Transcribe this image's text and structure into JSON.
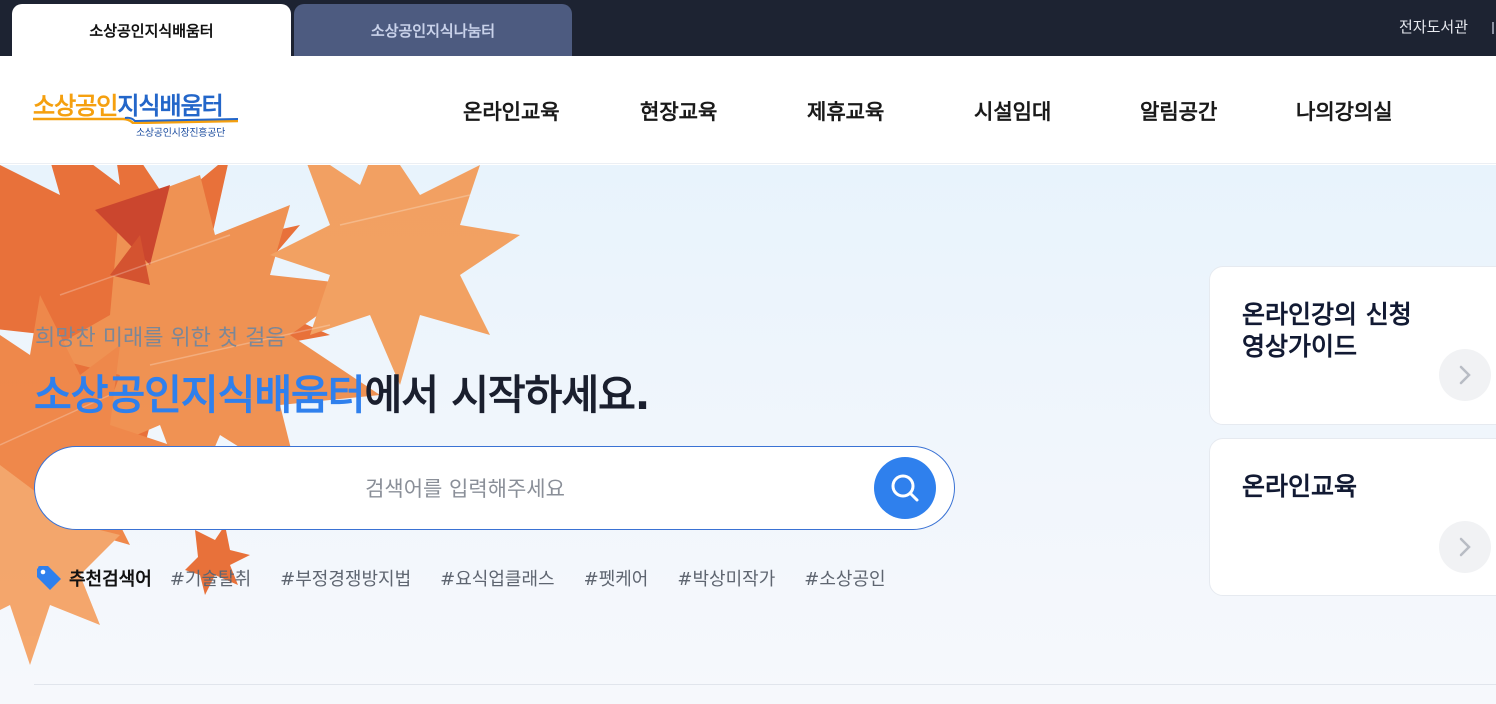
{
  "topbar": {
    "tabs": [
      {
        "label": "소상공인지식배움터",
        "active": true
      },
      {
        "label": "소상공인지식나눔터",
        "active": false
      }
    ],
    "right_link": "전자도서관"
  },
  "logo": {
    "title_part1": "소상공인",
    "title_part2": "지식배움터",
    "subtitle": "소상공인시장진흥공단"
  },
  "nav": [
    "온라인교육",
    "현장교육",
    "제휴교육",
    "시설임대",
    "알림공간",
    "나의강의실"
  ],
  "hero": {
    "tagline": "희망찬 미래를 위한 첫 걸음",
    "headline_highlight": "소상공인지식배움터",
    "headline_rest": "에서 시작하세요.",
    "search": {
      "placeholder": "검색어를 입력해주세요",
      "value": ""
    },
    "recommended": {
      "label": "추천검색어",
      "tags": [
        "#기술탈취",
        "#부정경쟁방지법",
        "#요식업클래스",
        "#펫케어",
        "#박상미작가",
        "#소상공인"
      ]
    }
  },
  "cards": [
    {
      "title_line1": "온라인강의 신청",
      "title_line2": "영상가이드"
    },
    {
      "title_line1": "온라인교육",
      "title_line2": ""
    }
  ],
  "colors": {
    "topbar_bg": "#1d2332",
    "accent_blue": "#2f80ed",
    "logo_orange": "#f5a00f",
    "logo_blue": "#2366c9",
    "leaf_orange": "#f07a2e"
  }
}
